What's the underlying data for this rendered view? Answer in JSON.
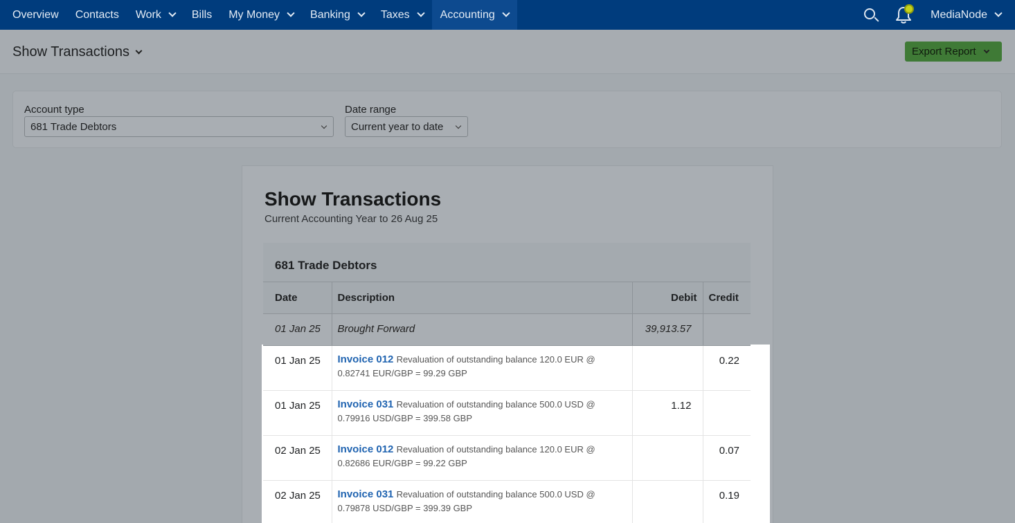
{
  "nav": {
    "items": [
      {
        "label": "Overview",
        "dropdown": false
      },
      {
        "label": "Contacts",
        "dropdown": false
      },
      {
        "label": "Work",
        "dropdown": true
      },
      {
        "label": "Bills",
        "dropdown": false
      },
      {
        "label": "My Money",
        "dropdown": true
      },
      {
        "label": "Banking",
        "dropdown": true
      },
      {
        "label": "Taxes",
        "dropdown": true
      },
      {
        "label": "Accounting",
        "dropdown": true,
        "active": true
      }
    ],
    "user": "MediaNode"
  },
  "header": {
    "title": "Show Transactions",
    "export_label": "Export Report"
  },
  "filters": {
    "account_label": "Account type",
    "account_value": "681 Trade Debtors",
    "date_label": "Date range",
    "date_value": "Current year to date"
  },
  "report": {
    "title": "Show Transactions",
    "subtitle": "Current Accounting Year to 26 Aug 25",
    "account": "681 Trade Debtors",
    "columns": {
      "date": "Date",
      "description": "Description",
      "debit": "Debit",
      "credit": "Credit"
    },
    "brought_forward": {
      "date": "01 Jan 25",
      "description": "Brought Forward",
      "debit": "39,913.57",
      "credit": ""
    },
    "rows": [
      {
        "date": "01 Jan 25",
        "link": "Invoice 012",
        "text": "Revaluation of outstanding balance 120.0 EUR @ 0.82741 EUR/GBP = 99.29 GBP",
        "debit": "",
        "credit": "0.22"
      },
      {
        "date": "01 Jan 25",
        "link": "Invoice 031",
        "text": "Revaluation of outstanding balance 500.0 USD @ 0.79916 USD/GBP = 399.58 GBP",
        "debit": "1.12",
        "credit": ""
      },
      {
        "date": "02 Jan 25",
        "link": "Invoice 012",
        "text": "Revaluation of outstanding balance 120.0 EUR @ 0.82686 EUR/GBP = 99.22 GBP",
        "debit": "",
        "credit": "0.07"
      },
      {
        "date": "02 Jan 25",
        "link": "Invoice 031",
        "text": "Revaluation of outstanding balance 500.0 USD @ 0.79878 USD/GBP = 399.39 GBP",
        "debit": "",
        "credit": "0.19"
      }
    ]
  },
  "colors": {
    "nav_bg": "#003c7d",
    "link": "#1f63b0",
    "export_bg": "#3f7a36",
    "notification": "#c6d31a"
  }
}
